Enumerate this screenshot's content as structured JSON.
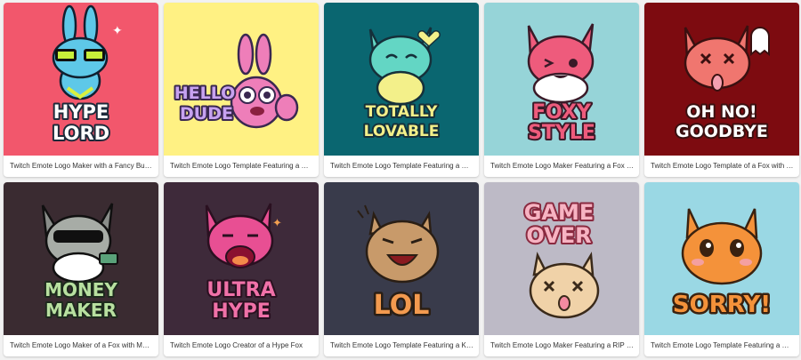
{
  "cards": [
    {
      "caption": "Twitch Emote Logo Maker with a Fancy Bunny",
      "logo_lines": [
        "HYPE",
        "LORD"
      ],
      "bg": "#f2576c",
      "accent": "#5ec8e8",
      "icon": "bunny-emote-icon"
    },
    {
      "caption": "Twitch Emote Logo Template Featuring a Happy Bunny",
      "logo_lines": [
        "HELLO",
        "DUDE"
      ],
      "bg": "#fff183",
      "accent": "#ee7eb9",
      "icon": "pink-bunny-emote-icon"
    },
    {
      "caption": "Twitch Emote Logo Template Featuring a Cute Fox",
      "logo_lines": [
        "TOTALLY",
        "LOVABLE"
      ],
      "bg": "#0a6670",
      "accent": "#63d6c4",
      "icon": "teal-fox-emote-icon"
    },
    {
      "caption": "Twitch Emote Logo Maker Featuring a Fox with Style",
      "logo_lines": [
        "FOXY",
        "STYLE"
      ],
      "bg": "#96d4d8",
      "accent": "#ee5b7c",
      "icon": "pink-fox-emote-icon"
    },
    {
      "caption": "Twitch Emote Logo Template of a Fox with a Ghost",
      "logo_lines": [
        "OH NO!",
        "GOODBYE"
      ],
      "bg": "#7d0b10",
      "accent": "#f0766f",
      "icon": "fox-ghost-emote-icon"
    },
    {
      "caption": "Twitch Emote Logo Maker of a Fox with Money",
      "logo_lines": [
        "MONEY",
        "MAKER"
      ],
      "bg": "#3a2b31",
      "accent": "#5aa27a",
      "icon": "money-fox-emote-icon"
    },
    {
      "caption": "Twitch Emote Logo Creator of a Hype Fox",
      "logo_lines": [
        "ULTRA",
        "HYPE"
      ],
      "bg": "#3e2a3a",
      "accent": "#e84f93",
      "icon": "hype-fox-emote-icon"
    },
    {
      "caption": "Twitch Emote Logo Template Featuring a Kitty Laughing",
      "logo_lines": [
        "LOL"
      ],
      "bg": "#393b4b",
      "accent": "#f39a4f",
      "icon": "laughing-kitty-emote-icon"
    },
    {
      "caption": "Twitch Emote Logo Maker Featuring a RIP Kitty",
      "logo_lines": [
        "GAME",
        "OVER"
      ],
      "bg": "#bdbac6",
      "accent": "#f4a7b6",
      "icon": "rip-kitty-emote-icon"
    },
    {
      "caption": "Twitch Emote Logo Template Featuring a Remorseful Kitty",
      "logo_lines": [
        "SORRY!"
      ],
      "bg": "#9ad8e4",
      "accent": "#f4923a",
      "icon": "sorry-kitty-emote-icon"
    }
  ]
}
